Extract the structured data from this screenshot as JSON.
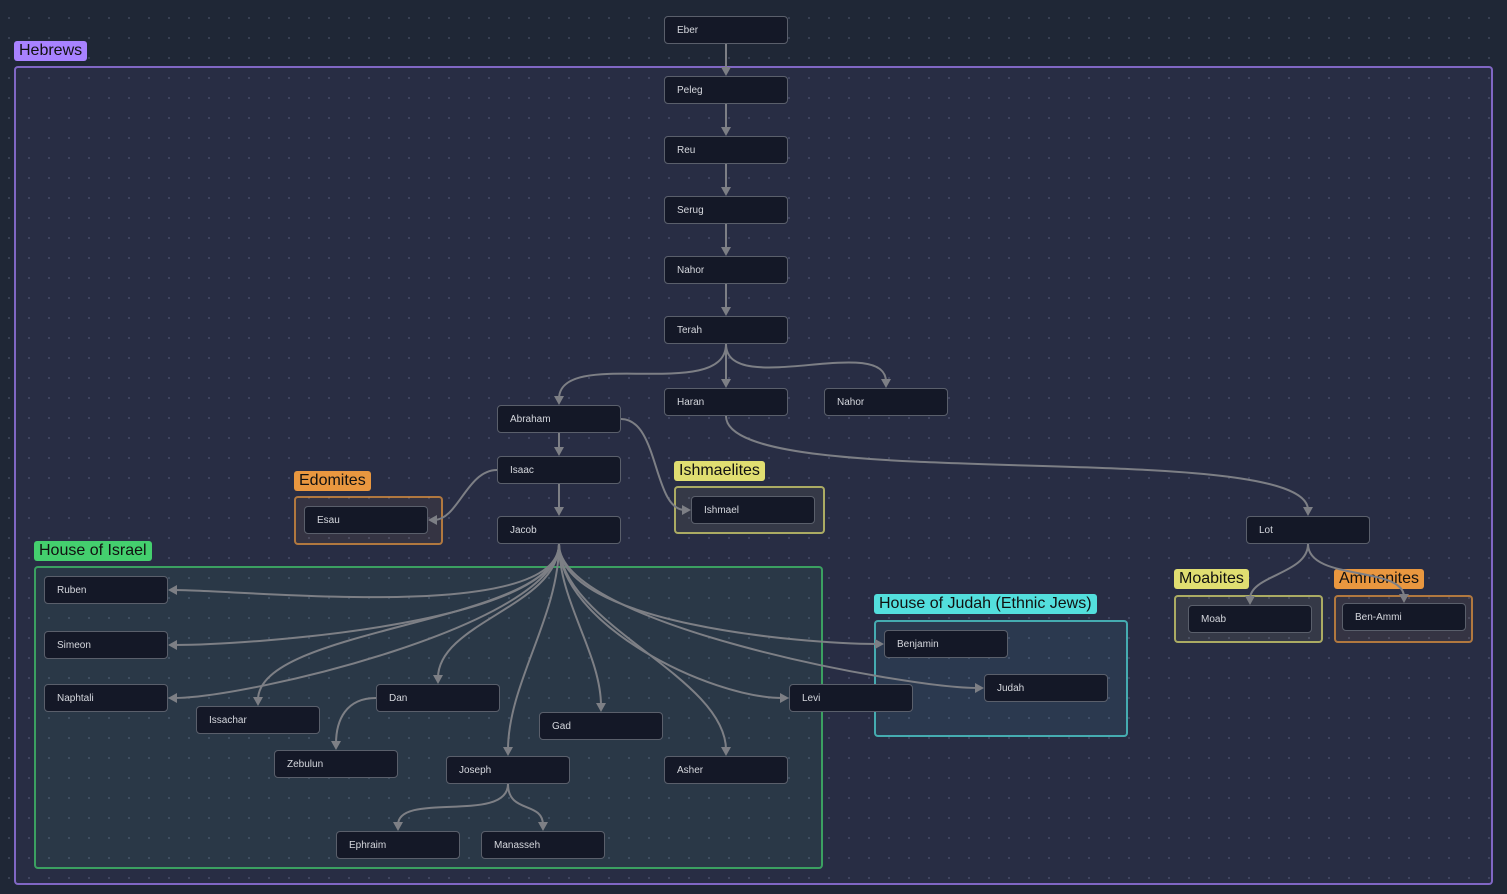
{
  "colors": {
    "purple": "#a882ff",
    "orange": "#e9973f",
    "yellow": "#e0de71",
    "green": "#44cf6e",
    "cyan": "#53dfdd",
    "edge": "#7d7f85"
  },
  "groups": [
    {
      "id": "hebrews",
      "label": "Hebrews",
      "color": "#a882ff"
    },
    {
      "id": "edomites",
      "label": "Edomites",
      "color": "#e9973f"
    },
    {
      "id": "ishmaelites",
      "label": "Ishmaelites",
      "color": "#e0de71"
    },
    {
      "id": "israel",
      "label": "House of Israel",
      "color": "#44cf6e"
    },
    {
      "id": "judah",
      "label": "House of Judah (Ethnic Jews)",
      "color": "#53dfdd"
    },
    {
      "id": "moabites",
      "label": "Moabites",
      "color": "#e0de71"
    },
    {
      "id": "ammonites",
      "label": "Ammonites",
      "color": "#e9973f"
    }
  ],
  "nodes": {
    "eber": "Eber",
    "peleg": "Peleg",
    "reu": "Reu",
    "serug": "Serug",
    "nahor": "Nahor",
    "terah": "Terah",
    "abraham": "Abraham",
    "haran": "Haran",
    "nahor2": "Nahor",
    "isaac": "Isaac",
    "jacob": "Jacob",
    "esau": "Esau",
    "ishmael": "Ishmael",
    "lot": "Lot",
    "moab": "Moab",
    "benammi": "Ben-Ammi",
    "ruben": "Ruben",
    "simeon": "Simeon",
    "naphtali": "Naphtali",
    "issachar": "Issachar",
    "dan": "Dan",
    "gad": "Gad",
    "levi": "Levi",
    "benjamin": "Benjamin",
    "judah": "Judah",
    "zebulun": "Zebulun",
    "joseph": "Joseph",
    "asher": "Asher",
    "ephraim": "Ephraim",
    "manasseh": "Manasseh"
  },
  "edges": [
    [
      "eber",
      "peleg"
    ],
    [
      "peleg",
      "reu"
    ],
    [
      "reu",
      "serug"
    ],
    [
      "serug",
      "nahor"
    ],
    [
      "nahor",
      "terah"
    ],
    [
      "terah",
      "abraham"
    ],
    [
      "terah",
      "haran"
    ],
    [
      "terah",
      "nahor2"
    ],
    [
      "abraham",
      "isaac"
    ],
    [
      "abraham",
      "ishmael"
    ],
    [
      "isaac",
      "esau"
    ],
    [
      "isaac",
      "jacob"
    ],
    [
      "haran",
      "lot"
    ],
    [
      "lot",
      "moab"
    ],
    [
      "lot",
      "benammi"
    ],
    [
      "jacob",
      "ruben"
    ],
    [
      "jacob",
      "simeon"
    ],
    [
      "jacob",
      "naphtali"
    ],
    [
      "jacob",
      "issachar"
    ],
    [
      "jacob",
      "dan"
    ],
    [
      "jacob",
      "gad"
    ],
    [
      "jacob",
      "levi"
    ],
    [
      "jacob",
      "benjamin"
    ],
    [
      "jacob",
      "judah"
    ],
    [
      "jacob",
      "joseph"
    ],
    [
      "jacob",
      "asher"
    ],
    [
      "dan",
      "zebulun"
    ],
    [
      "joseph",
      "ephraim"
    ],
    [
      "joseph",
      "manasseh"
    ]
  ]
}
